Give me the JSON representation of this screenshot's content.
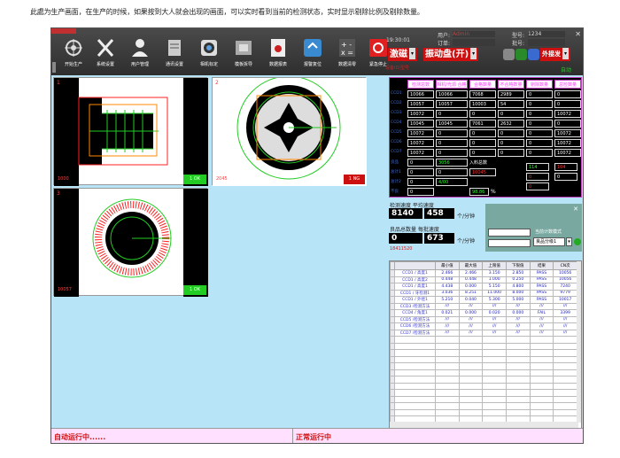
{
  "caption": "此處为生产画面，在生产的时候，如果按到大人就会出现的画面，可以实时看到当前的检测状态，实时显示剔除比例及剔除数量。",
  "toolbar": {
    "buttons": [
      {
        "label": "开始生产",
        "icon": "gear-sun-icon"
      },
      {
        "label": "系统设置",
        "icon": "wrench-screwdriver-icon"
      },
      {
        "label": "用户管理",
        "icon": "users-icon"
      },
      {
        "label": "通讯设置",
        "icon": "printer-icon"
      },
      {
        "label": "相机标定",
        "icon": "camera-lens-icon"
      },
      {
        "label": "模板拆导",
        "icon": "template-icon"
      },
      {
        "label": "数据报表",
        "icon": "report-icon"
      },
      {
        "label": "报警复位",
        "icon": "alarm-reset-icon"
      },
      {
        "label": "数据清零",
        "icon": "calculator-icon"
      },
      {
        "label": "紧急停止",
        "icon": "emergency-stop-icon"
      }
    ],
    "user_label": "用户:",
    "user_value": "Admin",
    "order_label": "订单:",
    "order_value": "",
    "model_label": "型号:",
    "model_value": "1234",
    "batch_label": "批号:",
    "batch_value": "",
    "datetime": "19:30:01",
    "mode_label": "自动运行",
    "vibe_button": "振动盘(开)",
    "laser_button": "激磁",
    "external_button": "外接发",
    "auto_label": "自动",
    "sub_label": "设备ID/型号"
  },
  "cameras": [
    {
      "id": "1000",
      "result": "1 OK",
      "corner": "1"
    },
    {
      "id": "2045",
      "result": "1 NG",
      "corner": "2"
    },
    {
      "id": "10057",
      "result": "1 OK",
      "corner": "3"
    }
  ],
  "stats": {
    "headers": [
      "检测总数",
      "相机/光源 合格",
      "合格数量",
      "不合格数量",
      "剔除数量",
      "总检数量"
    ],
    "row_labels": [
      "CCD1",
      "CCD2",
      "CCD3",
      "CCD4",
      "CCD5",
      "CCD6",
      "CCD7",
      "良品",
      "总计1",
      "总计2",
      "不良"
    ],
    "col1": [
      "10066",
      "10057",
      "10072",
      "10045",
      "10072",
      "10072",
      "10072",
      "0",
      "0",
      "0",
      "0"
    ],
    "col2": [
      "10066",
      "10057",
      "0",
      "10045",
      "0",
      "0",
      "0",
      "3056",
      "0",
      "4/00",
      ""
    ],
    "col3": [
      "7068",
      "10003",
      "0",
      "7061",
      "0",
      "0",
      "0"
    ],
    "col4": [
      "2989",
      "54",
      "0",
      "2632",
      "0",
      "0",
      "0"
    ],
    "col5": [
      "0",
      "0",
      "0",
      "0",
      "0",
      "0",
      "0",
      "114",
      "0",
      "0"
    ],
    "col6": [
      "0",
      "0",
      "10072",
      "0",
      "10072",
      "10072",
      "10072",
      "104",
      "0"
    ],
    "input_label": "入料总数",
    "input_value": "10045",
    "rate_value": "98.86",
    "rate_unit": "%"
  },
  "mid": {
    "speed_label": "检测速度 平均速度",
    "speed_value": "8140",
    "speed_avg": "458",
    "speed_unit": "个/分钟",
    "good_label": "良品总数量 每批速度",
    "good_value": "0",
    "good_avg": "673",
    "good_unit": "个/分钟",
    "batch_no": "18411520"
  },
  "popup": {
    "title": "当前计数模式",
    "select_value": "良品分级1"
  },
  "grid": {
    "headers": [
      "",
      "最小值",
      "最大值",
      "上限值",
      "下限值",
      "结果",
      "CN次"
    ],
    "rows": [
      [
        "CCD1 / 高度1",
        "2.466",
        "2.466",
        "3.150",
        "2.850",
        "PASS",
        "10056"
      ],
      [
        "CCD1 / 高度2",
        "0.448",
        "0.448",
        "1.000",
        "0.250",
        "PASS",
        "10056"
      ],
      [
        "CCD1 / 高度1",
        "4.438",
        "0.000",
        "5.150",
        "4.800",
        "PASS",
        "7240"
      ],
      [
        "CCD1 / 牙检测1",
        "3.036",
        "8.251",
        "11.000",
        "8.000",
        "PASS",
        "9779"
      ],
      [
        "CCD1 / 外径1",
        "5.210",
        "0.040",
        "5.300",
        "5.000",
        "PASS",
        "10017"
      ],
      [
        "CCD3 /检测方法",
        "///",
        "///",
        "///",
        "///",
        "///",
        "///"
      ],
      [
        "CCD4 / 角度1",
        "0.021",
        "0.000",
        "0.020",
        "0.000",
        "FAIL",
        "3399"
      ],
      [
        "CCD5 /检测方法",
        "///",
        "///",
        "///",
        "///",
        "///",
        "///"
      ],
      [
        "CCD6 /检测方法",
        "///",
        "///",
        "///",
        "///",
        "///",
        "///"
      ],
      [
        "CCD7 /检测方法",
        "///",
        "///",
        "///",
        "///",
        "///",
        "///"
      ]
    ]
  },
  "status": {
    "left": "自动运行中......",
    "right": "正常运行中"
  },
  "colors": {
    "app_bg": "#b8e4f8",
    "toolbar_bg": "#2e2e2e",
    "accent_red": "#cc1010",
    "ok_green": "#22cc22",
    "magenta": "#c040c0"
  }
}
